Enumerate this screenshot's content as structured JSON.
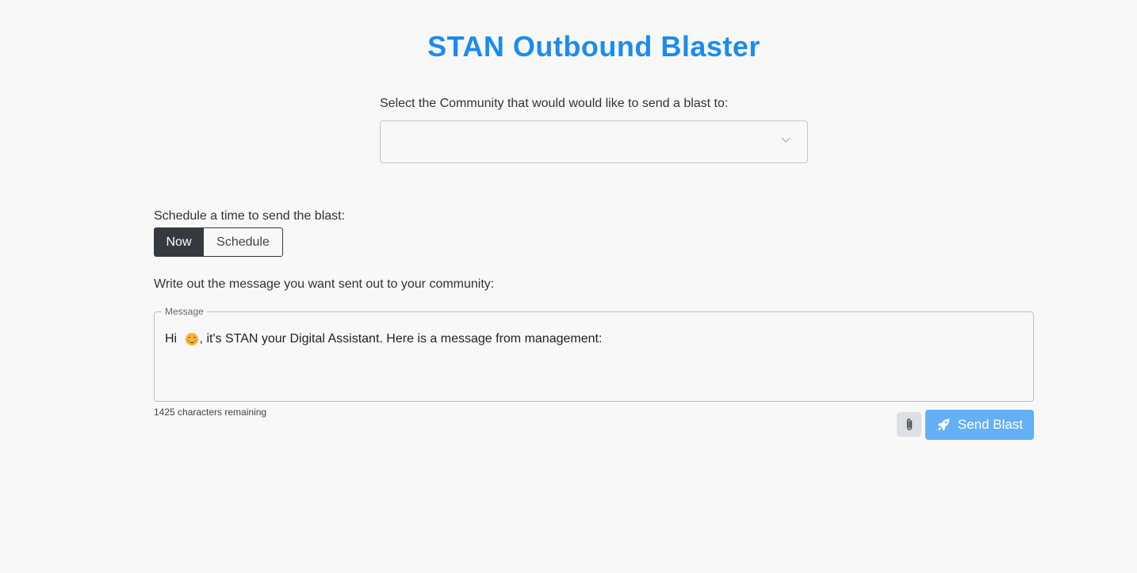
{
  "header": {
    "title": "STAN Outbound Blaster"
  },
  "community": {
    "label": "Select the Community that would would like to send a blast to:",
    "selected_value": "",
    "icon": "chevron-down-icon"
  },
  "schedule": {
    "label": "Schedule a time to send the blast:",
    "options": [
      {
        "label": "Now",
        "active": true
      },
      {
        "label": "Schedule",
        "active": false
      }
    ]
  },
  "message": {
    "label": "Write out the message you want sent out to your community:",
    "field_legend": "Message",
    "text_before_emoji": "Hi ",
    "emoji": "smiling-face-emoji",
    "text_after_emoji": ", it's STAN your Digital Assistant. Here is a message from management:",
    "chars_remaining": "1425 characters remaining"
  },
  "actions": {
    "attach_icon": "paperclip-icon",
    "send_icon": "rocket-icon",
    "send_label": "Send Blast"
  },
  "colors": {
    "title": "#1a8cf0",
    "send_button": "#63b0f7",
    "toggle_active": "#343a40",
    "attach_button": "#dcdfe4",
    "background": "#f8f8f8"
  }
}
